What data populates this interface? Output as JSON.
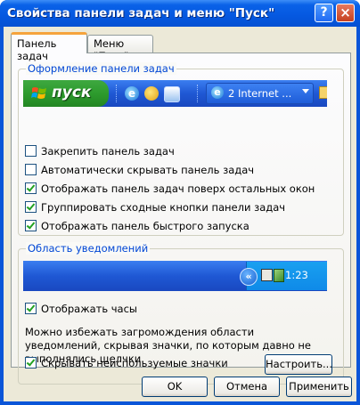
{
  "window": {
    "title": "Свойства панели задач и меню \"Пуск\"",
    "help_label": "?",
    "close_label": "×"
  },
  "tabs": [
    {
      "label": "Панель задач"
    },
    {
      "label": "Меню \"Пуск\""
    }
  ],
  "taskbar_group": {
    "label": "Оформление панели задач",
    "start_label": "пуск",
    "ie_task_label": "2 Internet ...",
    "checkboxes": [
      {
        "label": "Закрепить панель задач",
        "checked": false
      },
      {
        "label": "Автоматически скрывать панель задач",
        "checked": false
      },
      {
        "label": "Отображать панель задач поверх остальных окон",
        "checked": true
      },
      {
        "label": "Группировать сходные кнопки панели задач",
        "checked": true
      },
      {
        "label": "Отображать панель быстрого запуска",
        "checked": true
      }
    ]
  },
  "tray_group": {
    "label": "Область уведомлений",
    "clock_time": "1:23",
    "show_clock": {
      "label": "Отображать часы",
      "checked": true
    },
    "hint": "Можно избежать загромождения области уведомлений, скрывая значки, по которым давно не выполнялись щелчки.",
    "hide_inactive": {
      "label": "Скрывать неиспользуемые значки",
      "checked": true
    },
    "customize_label": "Настроить..."
  },
  "buttons": {
    "ok": "OK",
    "cancel": "Отмена",
    "apply": "Применить"
  },
  "colors": {
    "titlebar": "#0a55d8",
    "group_label": "#0046d5",
    "dialog_bg": "#ece9d8",
    "start_green": "#2d9b2d"
  }
}
